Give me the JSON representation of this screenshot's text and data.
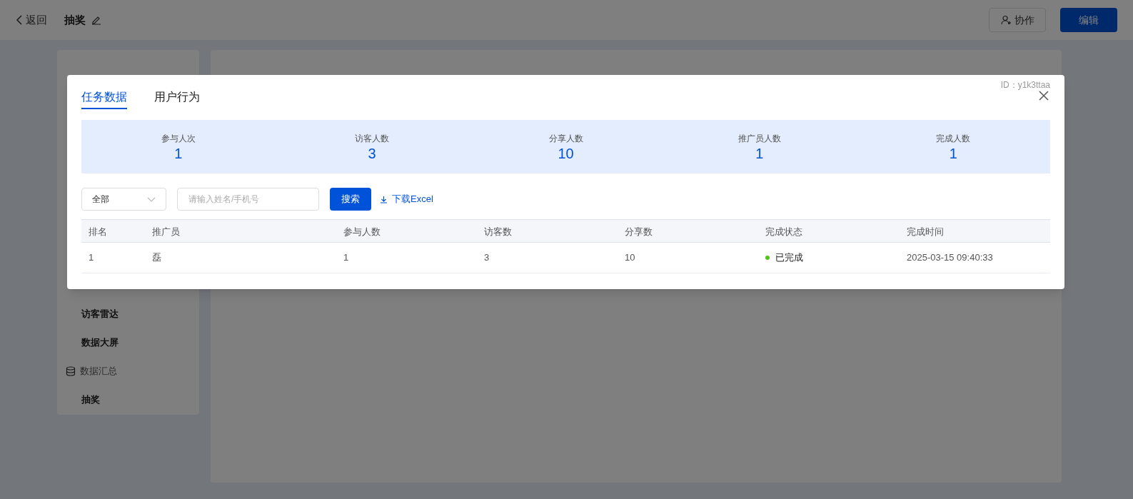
{
  "header": {
    "back": "返回",
    "title": "抽奖",
    "buttons": [
      {
        "kind": "outline",
        "label": "协作"
      },
      {
        "kind": "primary",
        "label": "编辑"
      }
    ]
  },
  "sidebar": {
    "items": [
      {
        "kind": "item",
        "label": "访客雷达"
      },
      {
        "kind": "item",
        "label": "数据大屏"
      },
      {
        "kind": "group",
        "label": "数据汇总"
      },
      {
        "kind": "item",
        "label": "抽奖"
      }
    ]
  },
  "modal": {
    "id_label": "ID：y1k3ttaa",
    "tabs": [
      {
        "label": "任务数据",
        "selected": true
      },
      {
        "label": "用户行为",
        "selected": false
      }
    ],
    "stats": [
      {
        "label": "参与人次",
        "value": "1"
      },
      {
        "label": "访客人数",
        "value": "3"
      },
      {
        "label": "分享人数",
        "value": "10"
      },
      {
        "label": "推广员人数",
        "value": "1"
      },
      {
        "label": "完成人数",
        "value": "1"
      }
    ],
    "filter": {
      "value": "全部"
    },
    "search": {
      "placeholder": "请输入姓名/手机号"
    },
    "search_button": "搜索",
    "download": "下载Excel",
    "table": {
      "columns": [
        "排名",
        "推广员",
        "参与人数",
        "访客数",
        "分享数",
        "完成状态",
        "完成时间"
      ],
      "rows": [
        {
          "cells": [
            "1",
            "磊",
            "1",
            "3",
            "10",
            "已完成",
            "2025-03-15 09:40:33"
          ],
          "color": "#52c41a"
        }
      ]
    }
  }
}
